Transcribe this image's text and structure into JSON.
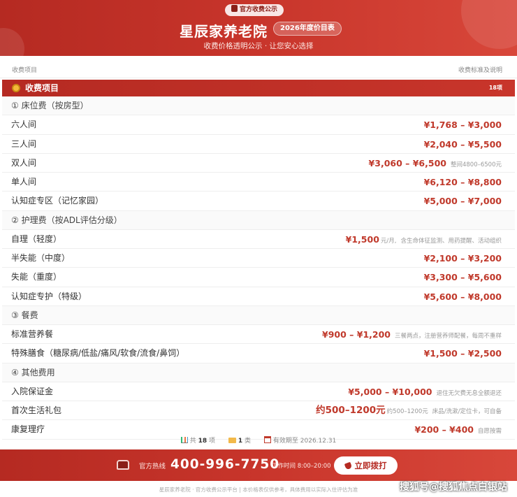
{
  "header": {
    "badge": "官方收费公示",
    "title": "星辰家养老院",
    "year_tag": "2026年度价目表",
    "subtitle": "收费价格透明公示 · 让您安心选择"
  },
  "column_header": {
    "left": "收费项目",
    "right": "收费标准及说明"
  },
  "section": {
    "title": "收费项目",
    "count": "18项"
  },
  "rows": [
    {
      "type": "group",
      "name": "① 床位费（按房型）"
    },
    {
      "type": "item",
      "name": "六人间",
      "price": "¥1,768 – ¥3,000",
      "note": ""
    },
    {
      "type": "item",
      "name": "三人间",
      "price": "¥2,040 – ¥5,500",
      "note": ""
    },
    {
      "type": "item",
      "name": "双人间",
      "price": "¥3,060 – ¥6,500",
      "note": "整间4800–6500元"
    },
    {
      "type": "item",
      "name": "单人间",
      "price": "¥6,120 – ¥8,800",
      "note": ""
    },
    {
      "type": "item",
      "name": "认知症专区（记忆家园）",
      "price": "¥5,000 – ¥7,000",
      "note": ""
    },
    {
      "type": "group",
      "name": "② 护理费（按ADL评估分级）"
    },
    {
      "type": "item",
      "name": "自理（轻度）",
      "price": "¥1,500",
      "unit": "元/月,",
      "note": "含生命体征监测、用药提醒、活动组织"
    },
    {
      "type": "item",
      "name": "半失能（中度）",
      "price": "¥2,100 – ¥3,200",
      "note": ""
    },
    {
      "type": "item",
      "name": "失能（重度）",
      "price": "¥3,300 – ¥5,600",
      "note": ""
    },
    {
      "type": "item",
      "name": "认知症专护（特级）",
      "price": "¥5,600 – ¥8,000",
      "note": ""
    },
    {
      "type": "group",
      "name": "③ 餐费"
    },
    {
      "type": "item",
      "name": "标准营养餐",
      "price": "¥900 – ¥1,200",
      "note": "三餐两点，注册营养师配餐，每周不重样"
    },
    {
      "type": "item",
      "name": "特殊膳食（糖尿病/低盐/痛风/软食/流食/鼻饲）",
      "price": "¥1,500 – ¥2,500",
      "note": ""
    },
    {
      "type": "group",
      "name": "④ 其他费用"
    },
    {
      "type": "item",
      "name": "入院保证金",
      "price": "¥5,000 – ¥10,000",
      "note": "退住无欠费无息全额退还"
    },
    {
      "type": "item",
      "name": "首次生活礼包",
      "price": "约500–1200元",
      "big": true,
      "unit": "约500–1200元",
      "note": "床品/洗漱/定位卡，可自备"
    },
    {
      "type": "item",
      "name": "康复理疗",
      "price": "¥200 – ¥400",
      "note": "自愿按需"
    }
  ],
  "summary": {
    "total_prefix": "共",
    "total": "18",
    "total_suffix": "项",
    "cats": "1",
    "cats_suffix": "类",
    "valid": "有效期至 2026.12.31"
  },
  "footer": {
    "hotline_label": "官方热线",
    "hotline": "400-996-7750",
    "hours": "工作时间 8:00–20:00",
    "call_button": "立即拨打",
    "bottom_note": "星辰家养老院 · 官方收费公示平台  |  本价格表仅供参考，具体费用以实际入住评估为准"
  },
  "watermark": "搜狐号@搜狐焦点白银站",
  "colors": {
    "brand_red": "#c8352b",
    "price_red": "#c0392b"
  }
}
